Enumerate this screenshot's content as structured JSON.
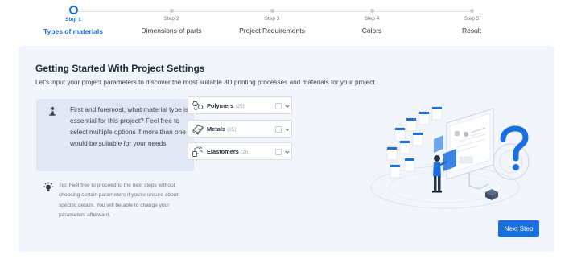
{
  "stepper": {
    "steps": [
      {
        "number": "Step 1",
        "name": "Types of materials",
        "active": true
      },
      {
        "number": "Step 2",
        "name": "Dimensions of parts",
        "active": false
      },
      {
        "number": "Step 3",
        "name": "Project Requirements",
        "active": false
      },
      {
        "number": "Step 4",
        "name": "Colors",
        "active": false
      },
      {
        "number": "Step 5",
        "name": "Result",
        "active": false
      }
    ]
  },
  "card": {
    "title": "Getting Started With Project Settings",
    "subtitle": "Let's input your project parameters to discover the most suitable 3D printing processes and materials for your project.",
    "question": "First and foremost, what material type is essential for this project? Feel free to select multiple options if more than one would be suitable for your needs.",
    "question_icon": "pawn-icon",
    "tip": "Tip: Feel free to proceed to the next steps without choosing certain parameters if you're unsure about specific details. You will be able to change your parameters afterward.",
    "tip_icon": "lightbulb-icon"
  },
  "materials": [
    {
      "label": "Polymers",
      "count": "(25)",
      "icon": "polymer-icon",
      "checked": false
    },
    {
      "label": "Metals",
      "count": "(25)",
      "icon": "metal-icon",
      "checked": false
    },
    {
      "label": "Elastomers",
      "count": "(25)",
      "icon": "elastomer-icon",
      "checked": false
    }
  ],
  "actions": {
    "next_label": "Next Step"
  },
  "colors": {
    "accent": "#1a6fe0",
    "card_bg": "#f2f5fb",
    "question_bg": "#e2e8f3"
  }
}
